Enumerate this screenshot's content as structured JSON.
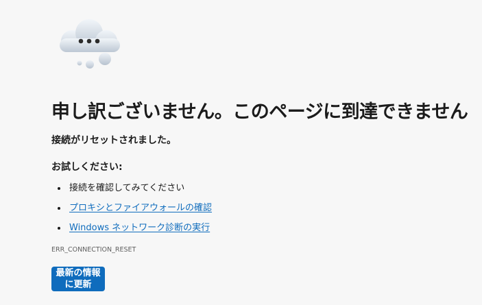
{
  "illustration": {
    "icon": "cloud-with-ellipsis-icon",
    "colors": {
      "cloud_light": "#e6ecf3",
      "cloud_shade": "#b9c4d1",
      "dots": "#2b2b2b"
    }
  },
  "error": {
    "heading": "申し訳ございません。このページに到達できません",
    "subtitle": "接続がリセットされました。",
    "code": "ERR_CONNECTION_RESET"
  },
  "suggestions": {
    "heading": "お試しください:",
    "items": [
      {
        "text": "接続を確認してみてください",
        "is_link": false
      },
      {
        "text": "プロキシとファイアウォールの確認",
        "is_link": true
      },
      {
        "text": "Windows ネットワーク診断の実行",
        "is_link": true
      }
    ]
  },
  "actions": {
    "refresh_label": "最新の情報に更新"
  },
  "colors": {
    "background": "#f7f7f7",
    "text": "#1b1b1b",
    "link": "#0f6cbd",
    "button_bg": "#0f6cbd",
    "button_text": "#ffffff",
    "muted": "#5f5f5f"
  }
}
